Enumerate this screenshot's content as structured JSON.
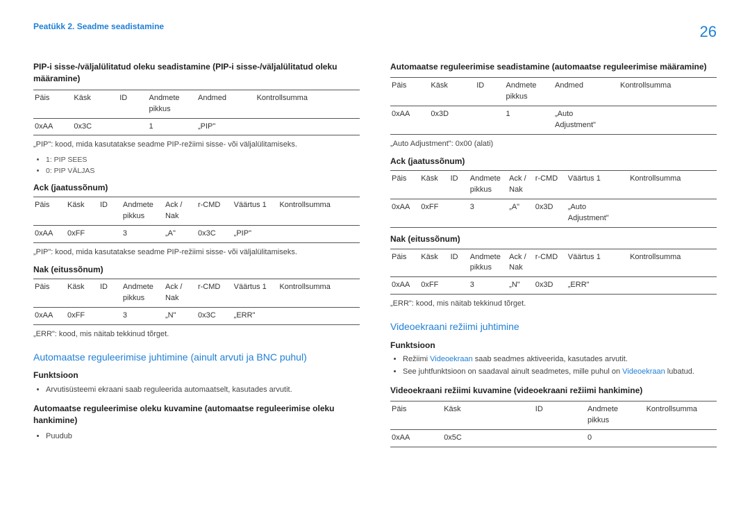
{
  "header": {
    "breadcrumb": "Peatükk 2. Seadme seadistamine",
    "page_number": "26"
  },
  "left": {
    "section1_title": "PIP-i sisse-/väljalülitatud oleku seadistamine (PIP-i sisse-/väljalülitatud oleku määramine)",
    "table1": {
      "headers": [
        "Päis",
        "Käsk",
        "ID",
        "Andmete pikkus",
        "Andmed",
        "Kontrollsumma"
      ],
      "rows": [
        [
          "0xAA",
          "0x3C",
          "",
          "1",
          "„PIP\"",
          ""
        ]
      ]
    },
    "pip_note": "„PIP\": kood, mida kasutatakse seadme PIP-režiimi sisse- või väljalülitamiseks.",
    "pip_list": [
      "1: PIP SEES",
      "0: PIP VÄLJAS"
    ],
    "ack_title": "Ack (jaatussõnum)",
    "table2": {
      "headers": [
        "Päis",
        "Käsk",
        "ID",
        "Andmete pikkus",
        "Ack / Nak",
        "r-CMD",
        "Väärtus 1",
        "Kontrollsumma"
      ],
      "rows": [
        [
          "0xAA",
          "0xFF",
          "",
          "3",
          "„A\"",
          "0x3C",
          "„PIP\"",
          ""
        ]
      ]
    },
    "ack_note": "„PIP\": kood, mida kasutatakse seadme PIP-režiimi sisse- või väljalülitamiseks.",
    "nak_title": "Nak (eitussõnum)",
    "table3": {
      "headers": [
        "Päis",
        "Käsk",
        "ID",
        "Andmete pikkus",
        "Ack / Nak",
        "r-CMD",
        "Väärtus 1",
        "Kontrollsumma"
      ],
      "rows": [
        [
          "0xAA",
          "0xFF",
          "",
          "3",
          "„N\"",
          "0x3C",
          "„ERR\"",
          ""
        ]
      ]
    },
    "err_note": "„ERR\": kood, mis näitab tekkinud tõrget.",
    "blue_heading": "Automaatse reguleerimise juhtimine (ainult arvuti ja BNC puhul)",
    "func_title": "Funktsioon",
    "func_list": [
      "Arvutisüsteemi ekraani saab reguleerida automaatselt, kasutades arvutit."
    ],
    "section2_title": "Automaatse reguleerimise oleku kuvamine (automaatse reguleerimise oleku hankimine)",
    "section2_list": [
      "Puudub"
    ]
  },
  "right": {
    "section1_title": "Automaatse reguleerimise seadistamine (automaatse reguleerimise määramine)",
    "table1": {
      "headers": [
        "Päis",
        "Käsk",
        "ID",
        "Andmete pikkus",
        "Andmed",
        "Kontrollsumma"
      ],
      "rows": [
        [
          "0xAA",
          "0x3D",
          "",
          "1",
          "„Auto Adjustment\"",
          ""
        ]
      ]
    },
    "auto_note": "„Auto Adjustment\": 0x00 (alati)",
    "ack_title": "Ack (jaatussõnum)",
    "table2": {
      "headers": [
        "Päis",
        "Käsk",
        "ID",
        "Andmete pikkus",
        "Ack / Nak",
        "r-CMD",
        "Väärtus 1",
        "Kontrollsumma"
      ],
      "rows": [
        [
          "0xAA",
          "0xFF",
          "",
          "3",
          "„A\"",
          "0x3D",
          "„Auto Adjustment\"",
          ""
        ]
      ]
    },
    "nak_title": "Nak (eitussõnum)",
    "table3": {
      "headers": [
        "Päis",
        "Käsk",
        "ID",
        "Andmete pikkus",
        "Ack / Nak",
        "r-CMD",
        "Väärtus 1",
        "Kontrollsumma"
      ],
      "rows": [
        [
          "0xAA",
          "0xFF",
          "",
          "3",
          "„N\"",
          "0x3D",
          "„ERR\"",
          ""
        ]
      ]
    },
    "err_note": "„ERR\": kood, mis näitab tekkinud tõrget.",
    "blue_heading": "Videoekraani režiimi juhtimine",
    "func_title": "Funktsioon",
    "func_pref1": "Režiimi ",
    "func_link1": "Videoekraan",
    "func_suf1": " saab seadmes aktiveerida, kasutades arvutit.",
    "func_pref2": "See juhtfunktsioon on saadaval ainult seadmetes, mille puhul on ",
    "func_link2": "Videoekraan",
    "func_suf2": " lubatud.",
    "section2_title": "Videoekraani režiimi kuvamine (videoekraani režiimi hankimine)",
    "table4": {
      "headers": [
        "Päis",
        "Käsk",
        "ID",
        "Andmete pikkus",
        "Kontrollsumma"
      ],
      "rows": [
        [
          "0xAA",
          "0x5C",
          "",
          "0",
          ""
        ]
      ]
    }
  }
}
